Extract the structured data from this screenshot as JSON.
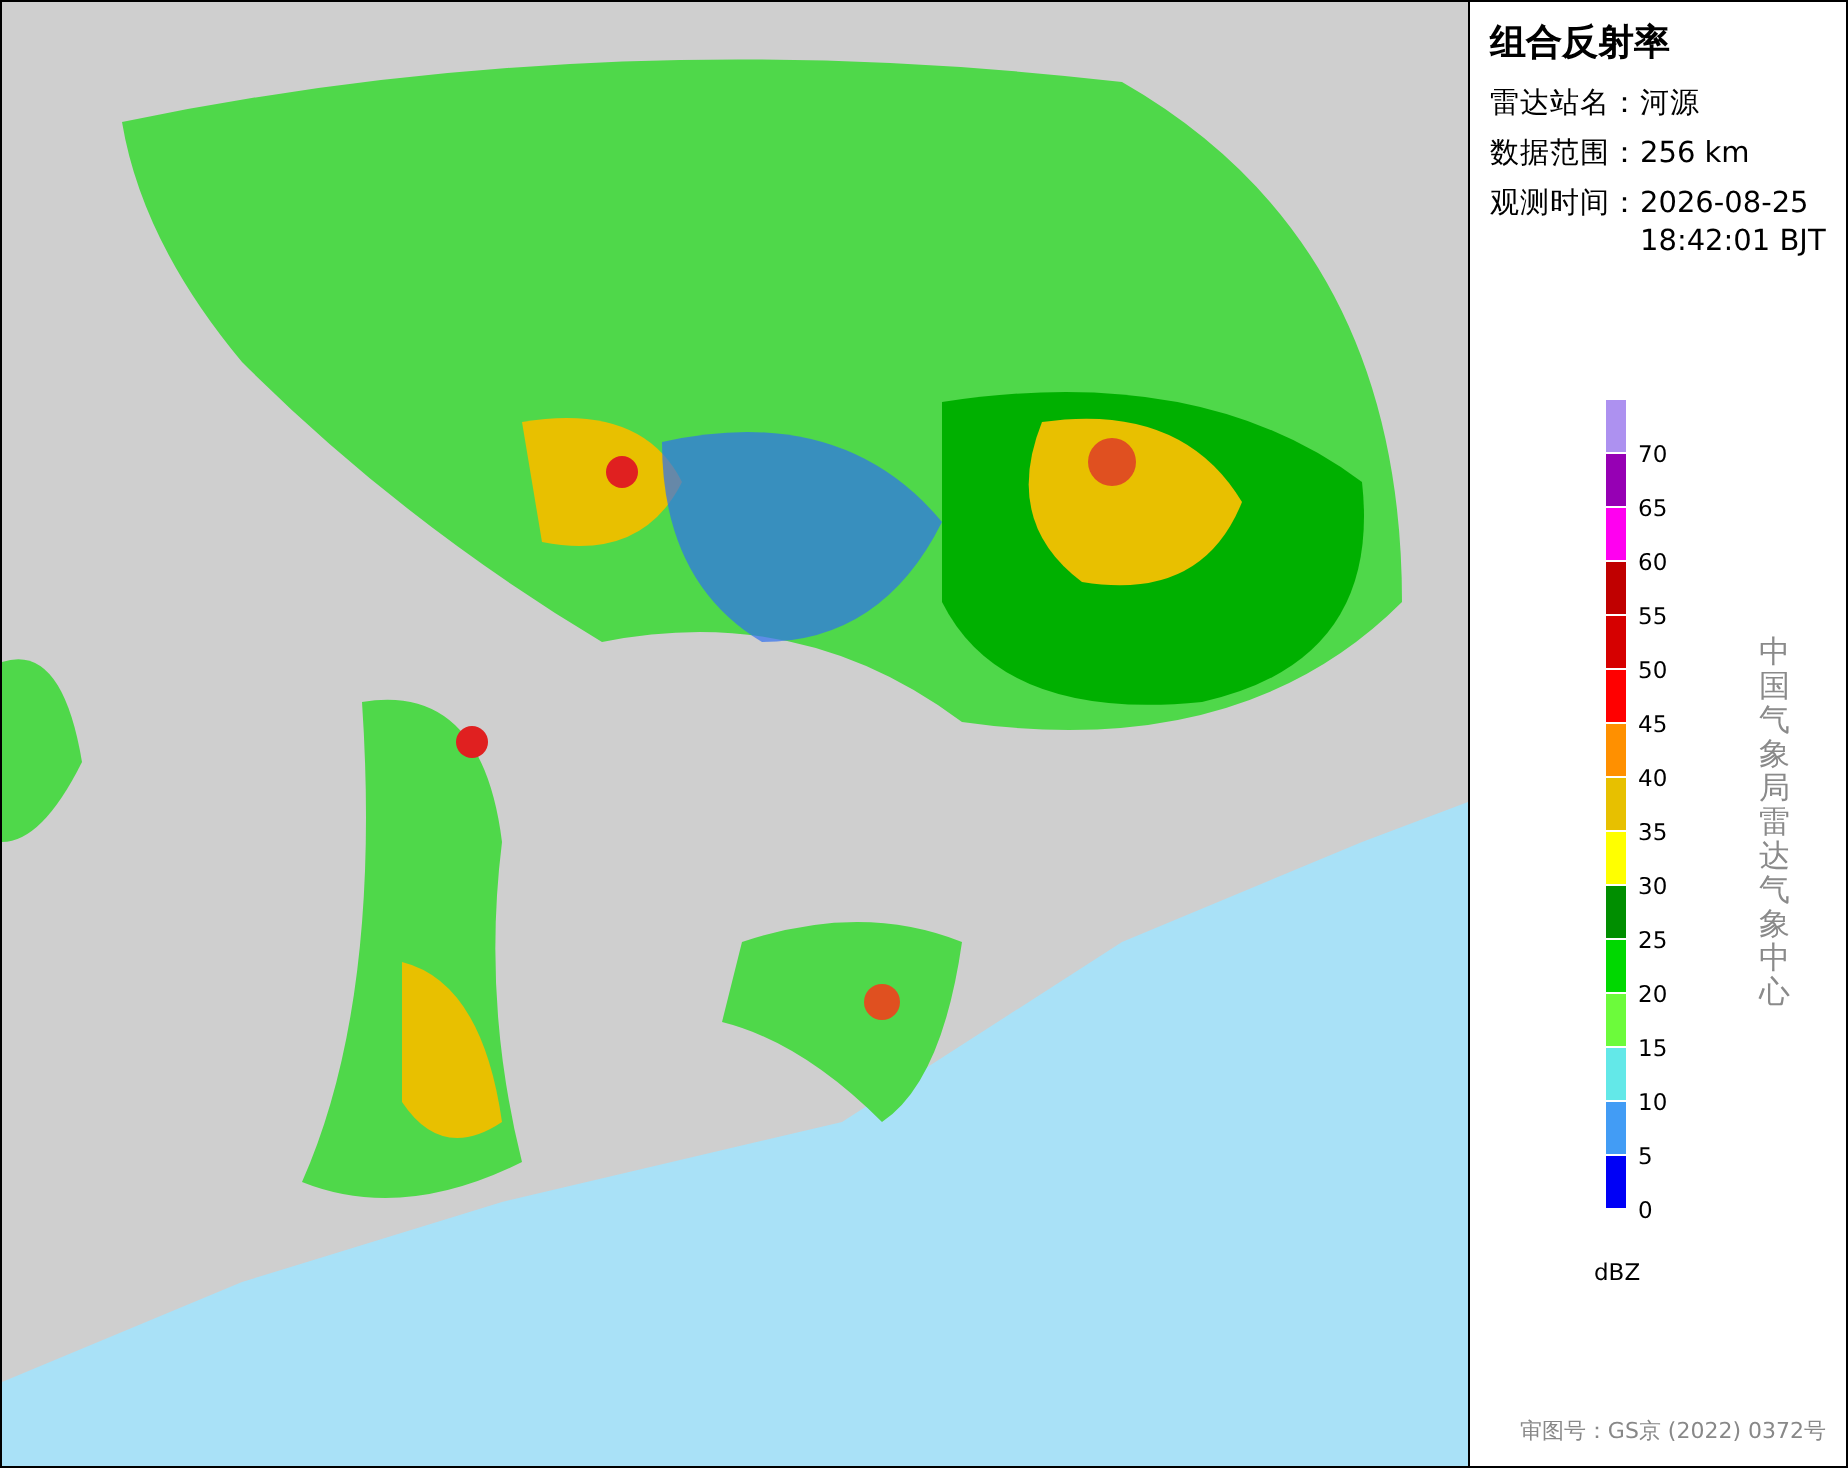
{
  "panel": {
    "title": "组合反射率",
    "info": [
      {
        "label": "雷达站名：",
        "lines": [
          "河源"
        ]
      },
      {
        "label": "数据范围：",
        "lines": [
          "256 km"
        ]
      },
      {
        "label": "观测时间：",
        "lines": [
          "2026-08-25",
          "18:42:01 BJT"
        ]
      }
    ],
    "legend": {
      "bins": [
        {
          "color": "#ad91f0"
        },
        {
          "color": "#9600b4"
        },
        {
          "color": "#ff00f0"
        },
        {
          "color": "#c00000"
        },
        {
          "color": "#d60000"
        },
        {
          "color": "#ff0000"
        },
        {
          "color": "#ff9000"
        },
        {
          "color": "#e7c000"
        },
        {
          "color": "#ffff00"
        },
        {
          "color": "#008e00"
        },
        {
          "color": "#00d800"
        },
        {
          "color": "#6cfb3b"
        },
        {
          "color": "#63e8e8"
        },
        {
          "color": "#429cf5"
        },
        {
          "color": "#0000f6"
        }
      ],
      "ticks": [
        "70",
        "65",
        "60",
        "55",
        "50",
        "45",
        "40",
        "35",
        "30",
        "25",
        "20",
        "15",
        "10",
        "5",
        "0"
      ],
      "unit": "dBZ"
    },
    "credit": "中国气象局雷达气象中心",
    "approval": "审图号：GS京 (2022) 0372号"
  }
}
